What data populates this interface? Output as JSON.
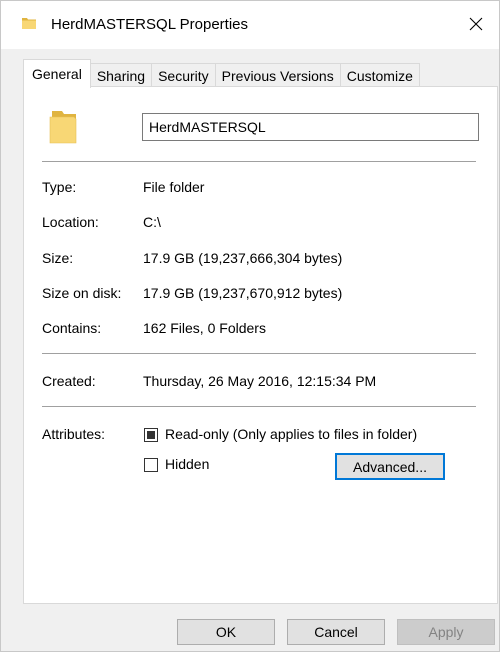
{
  "window": {
    "title": "HerdMASTERSQL Properties",
    "title_icon": "folder-icon",
    "close_icon": "close-icon"
  },
  "tabs": [
    {
      "label": "General",
      "active": true
    },
    {
      "label": "Sharing",
      "active": false
    },
    {
      "label": "Security",
      "active": false
    },
    {
      "label": "Previous Versions",
      "active": false
    },
    {
      "label": "Customize",
      "active": false
    }
  ],
  "general": {
    "folder_name": "HerdMASTERSQL",
    "type_label": "Type:",
    "type_value": "File folder",
    "location_label": "Location:",
    "location_value": "C:\\",
    "size_label": "Size:",
    "size_value": "17.9 GB (19,237,666,304 bytes)",
    "size_on_disk_label": "Size on disk:",
    "size_on_disk_value": "17.9 GB (19,237,670,912 bytes)",
    "contains_label": "Contains:",
    "contains_value": "162 Files, 0 Folders",
    "created_label": "Created:",
    "created_value": "Thursday, 26 May 2016, 12:15:34 PM",
    "attributes_label": "Attributes:",
    "readonly_label": "Read-only (Only applies to files in folder)",
    "readonly_state": "indeterminate",
    "hidden_label": "Hidden",
    "hidden_checked": false,
    "advanced_label": "Advanced..."
  },
  "buttons": {
    "ok": "OK",
    "cancel": "Cancel",
    "apply": "Apply"
  },
  "colors": {
    "folder_yellow": "#f8d775",
    "folder_dark": "#e0b440",
    "focus_blue": "#0078d7"
  }
}
